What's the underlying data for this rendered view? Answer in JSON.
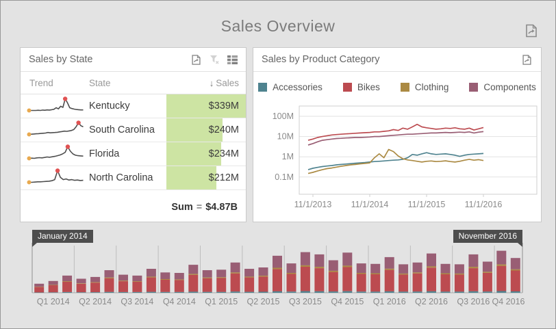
{
  "window": {
    "title": "Sales Overview"
  },
  "icons": {
    "sort_descending": "↓",
    "header": [
      "export-icon"
    ],
    "state_panel_toolbar": [
      "export-icon",
      "clear-filter-icon",
      "card-layout-icon"
    ],
    "category_panel_toolbar": [
      "export-icon"
    ]
  },
  "colors": {
    "background": "#e3e3e3",
    "panel_border": "#c9c9c9",
    "accessories": "#4f838f",
    "bikes": "#bc4b50",
    "clothing": "#ab8a43",
    "components": "#995e74",
    "databar_green": "#cde4a3",
    "sparkline_line": "#4d4d4d",
    "sparkline_start_dot": "#e8a94f",
    "sparkline_max_dot": "#e05252",
    "flag_bg": "#4d4d4d"
  },
  "sales_by_state": {
    "title": "Sales by State",
    "columns": {
      "trend": "Trend",
      "state": "State",
      "sales": "Sales"
    },
    "sort": {
      "column": "Sales",
      "direction": "descending"
    },
    "max_value": 339,
    "rows": [
      {
        "state": "Kentucky",
        "sales": "$339M",
        "value": 339,
        "trend": [
          2,
          2,
          2,
          2,
          2.1,
          2,
          2.2,
          2.1,
          2.3,
          2.2,
          2.4,
          2.6,
          3.4,
          2.8,
          4.2,
          3.6,
          8,
          6,
          3.4,
          3,
          2.7,
          2.5,
          2.4,
          2.3,
          2.3
        ]
      },
      {
        "state": "South Carolina",
        "sales": "$240M",
        "value": 240,
        "trend": [
          1.5,
          1.6,
          1.7,
          1.8,
          1.9,
          2,
          2.1,
          2.2,
          2.5,
          2.3,
          2.4,
          2.5,
          2.6,
          2.8,
          3,
          3.2,
          3.1,
          3.3,
          3.5,
          4,
          5.5,
          7.5,
          6,
          5.4
        ]
      },
      {
        "state": "Florida",
        "sales": "$234M",
        "value": 234,
        "trend": [
          1.8,
          1.9,
          1.8,
          2,
          2.1,
          2,
          2.2,
          2.4,
          2.3,
          2.5,
          2.7,
          3,
          3.3,
          3.8,
          4.5,
          7,
          5,
          3.8,
          3.2,
          3,
          2.9,
          2.8
        ]
      },
      {
        "state": "North Carolina",
        "sales": "$212M",
        "value": 212,
        "trend": [
          1.8,
          1.8,
          1.9,
          2,
          2,
          2.1,
          2.2,
          2.3,
          2.5,
          3,
          7,
          4,
          3,
          3.3,
          2.8,
          3,
          2.7,
          2.8,
          2.6,
          2.7
        ]
      }
    ],
    "summary": {
      "label": "Sum",
      "equals": "=",
      "value": "$4.87B"
    }
  },
  "sales_by_category": {
    "title": "Sales by Product Category"
  },
  "range_selector": {
    "start_flag": "January 2014",
    "end_flag": "November 2016"
  },
  "chart_data": [
    {
      "type": "line",
      "title": "Sales by Product Category",
      "y_scale": "log",
      "ylabel": "",
      "xlabel": "",
      "grid": "horizontal",
      "legend_position": "top",
      "y_ticks": [
        {
          "value": 100,
          "label": "100M"
        },
        {
          "value": 10,
          "label": "10M"
        },
        {
          "value": 1,
          "label": "1M"
        },
        {
          "value": 0.1,
          "label": "0.1M"
        }
      ],
      "x_ticks": [
        "11/1/2013",
        "11/1/2014",
        "11/1/2015",
        "11/1/2016"
      ],
      "x_start": "2013-10",
      "x_end": "2016-11",
      "x_interval": "month",
      "series": [
        {
          "name": "Accessories",
          "color": "#4f838f",
          "values": [
            0.23,
            0.27,
            0.3,
            0.33,
            0.35,
            0.37,
            0.4,
            0.42,
            0.44,
            0.46,
            0.48,
            0.5,
            0.52,
            0.55,
            0.58,
            0.6,
            0.62,
            0.65,
            0.68,
            0.7,
            0.75,
            0.9,
            1.3,
            1.2,
            1.4,
            1.6,
            1.4,
            1.3,
            1.35,
            1.4,
            1.3,
            1.2,
            1.05,
            1.2,
            1.3,
            1.35,
            1.4,
            1.45
          ]
        },
        {
          "name": "Bikes",
          "color": "#bc4b50",
          "values": [
            6.5,
            7.5,
            9,
            10,
            11,
            12,
            12.5,
            13,
            13.5,
            14,
            14.5,
            15,
            15.5,
            16,
            17,
            17,
            18,
            19,
            22,
            20,
            26,
            23,
            30,
            40,
            30,
            27,
            25,
            23,
            24,
            26,
            25,
            27,
            24,
            23,
            26,
            21,
            24,
            28
          ]
        },
        {
          "name": "Clothing",
          "color": "#ab8a43",
          "values": [
            0.15,
            0.17,
            0.2,
            0.23,
            0.26,
            0.28,
            0.31,
            0.34,
            0.37,
            0.4,
            0.42,
            0.45,
            0.47,
            0.5,
            0.9,
            1.4,
            0.9,
            2.3,
            1.8,
            1.1,
            0.8,
            0.7,
            0.65,
            0.6,
            0.55,
            0.6,
            0.62,
            0.58,
            0.6,
            0.63,
            0.58,
            0.55,
            0.6,
            0.68,
            0.75,
            0.68,
            0.72,
            0.65
          ]
        },
        {
          "name": "Components",
          "color": "#995e74",
          "values": [
            3.8,
            4.5,
            5.5,
            6.5,
            7,
            7.5,
            8,
            8.2,
            8.5,
            8.7,
            9,
            9,
            9.2,
            9.5,
            10,
            10,
            10.5,
            11,
            11.5,
            12,
            12.5,
            13,
            13,
            13.5,
            14,
            14.5,
            15,
            15,
            15.5,
            16,
            15.5,
            16,
            16.5,
            16,
            17,
            15,
            16.5,
            17.5
          ]
        }
      ]
    },
    {
      "type": "stacked-bar",
      "role": "range-selector",
      "x_start": "2014-01",
      "x_end": "2016-11",
      "x_interval": "month",
      "selection": {
        "start": "January 2014",
        "end": "November 2016"
      },
      "quarter_labels": [
        "Q1 2014",
        "Q2 2014",
        "Q3 2014",
        "Q4 2014",
        "Q1 2015",
        "Q2 2015",
        "Q3 2015",
        "Q4 2015",
        "Q1 2016",
        "Q2 2016",
        "Q3 2016",
        "Q4 2016"
      ],
      "totals": [
        20,
        26,
        38,
        31,
        35,
        50,
        40,
        38,
        53,
        45,
        44,
        62,
        50,
        51,
        67,
        53,
        56,
        82,
        65,
        90,
        85,
        72,
        89,
        65,
        64,
        79,
        63,
        67,
        87,
        64,
        63,
        85,
        69,
        93,
        77
      ],
      "stack": [
        {
          "name": "Accessories",
          "color": "#4f838f",
          "fraction": 0.04
        },
        {
          "name": "Bikes",
          "color": "#bc4b50",
          "fraction": 0.6
        },
        {
          "name": "Clothing",
          "color": "#ab8a43",
          "fraction": 0.035
        },
        {
          "name": "Components",
          "color": "#995e74",
          "fraction": 0.325
        }
      ]
    }
  ]
}
